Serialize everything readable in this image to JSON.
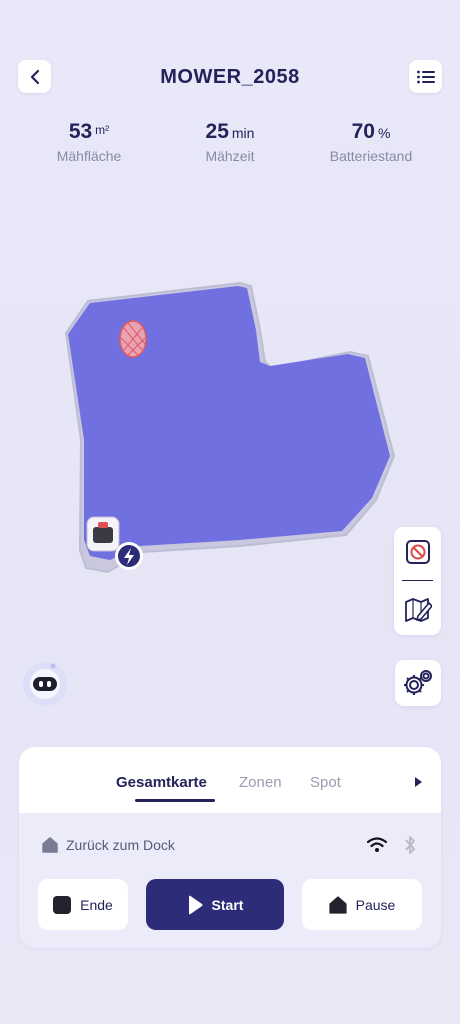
{
  "header": {
    "title": "MOWER_2058",
    "back_icon": "chevron-left-icon",
    "menu_icon": "list-icon"
  },
  "stats": [
    {
      "value": "53",
      "unit": "m²",
      "label": "Mähfläche"
    },
    {
      "value": "25",
      "unit": "min",
      "label": "Mähzeit"
    },
    {
      "value": "70",
      "unit": "%",
      "label": "Batteriestand"
    }
  ],
  "map": {
    "lawn_color": "#7170e0",
    "outline_color": "#c7c7dc",
    "no_go_zone_color": "#e45a5a",
    "mower_icon": "mower-icon",
    "dock_icon": "charging-dock-icon"
  },
  "side_tools": {
    "no_go_icon": "no-go-zone-icon",
    "edit_map_icon": "edit-map-icon",
    "settings_icon": "settings-gear-icon"
  },
  "assistant": {
    "icon": "robot-assistant-icon"
  },
  "bottom_card": {
    "tabs": [
      "Gesamtkarte",
      "Zonen",
      "Spot"
    ],
    "active_tab": "Gesamtkarte",
    "status_text": "Zurück zum Dock",
    "status_icon": "home-icon",
    "wifi_icon": "wifi-icon",
    "bluetooth_icon": "bluetooth-icon",
    "buttons": {
      "end": "Ende",
      "start": "Start",
      "pause": "Pause"
    }
  },
  "colors": {
    "accent": "#2c2c78",
    "text_primary": "#23235a",
    "text_secondary": "#8a8aa4"
  }
}
